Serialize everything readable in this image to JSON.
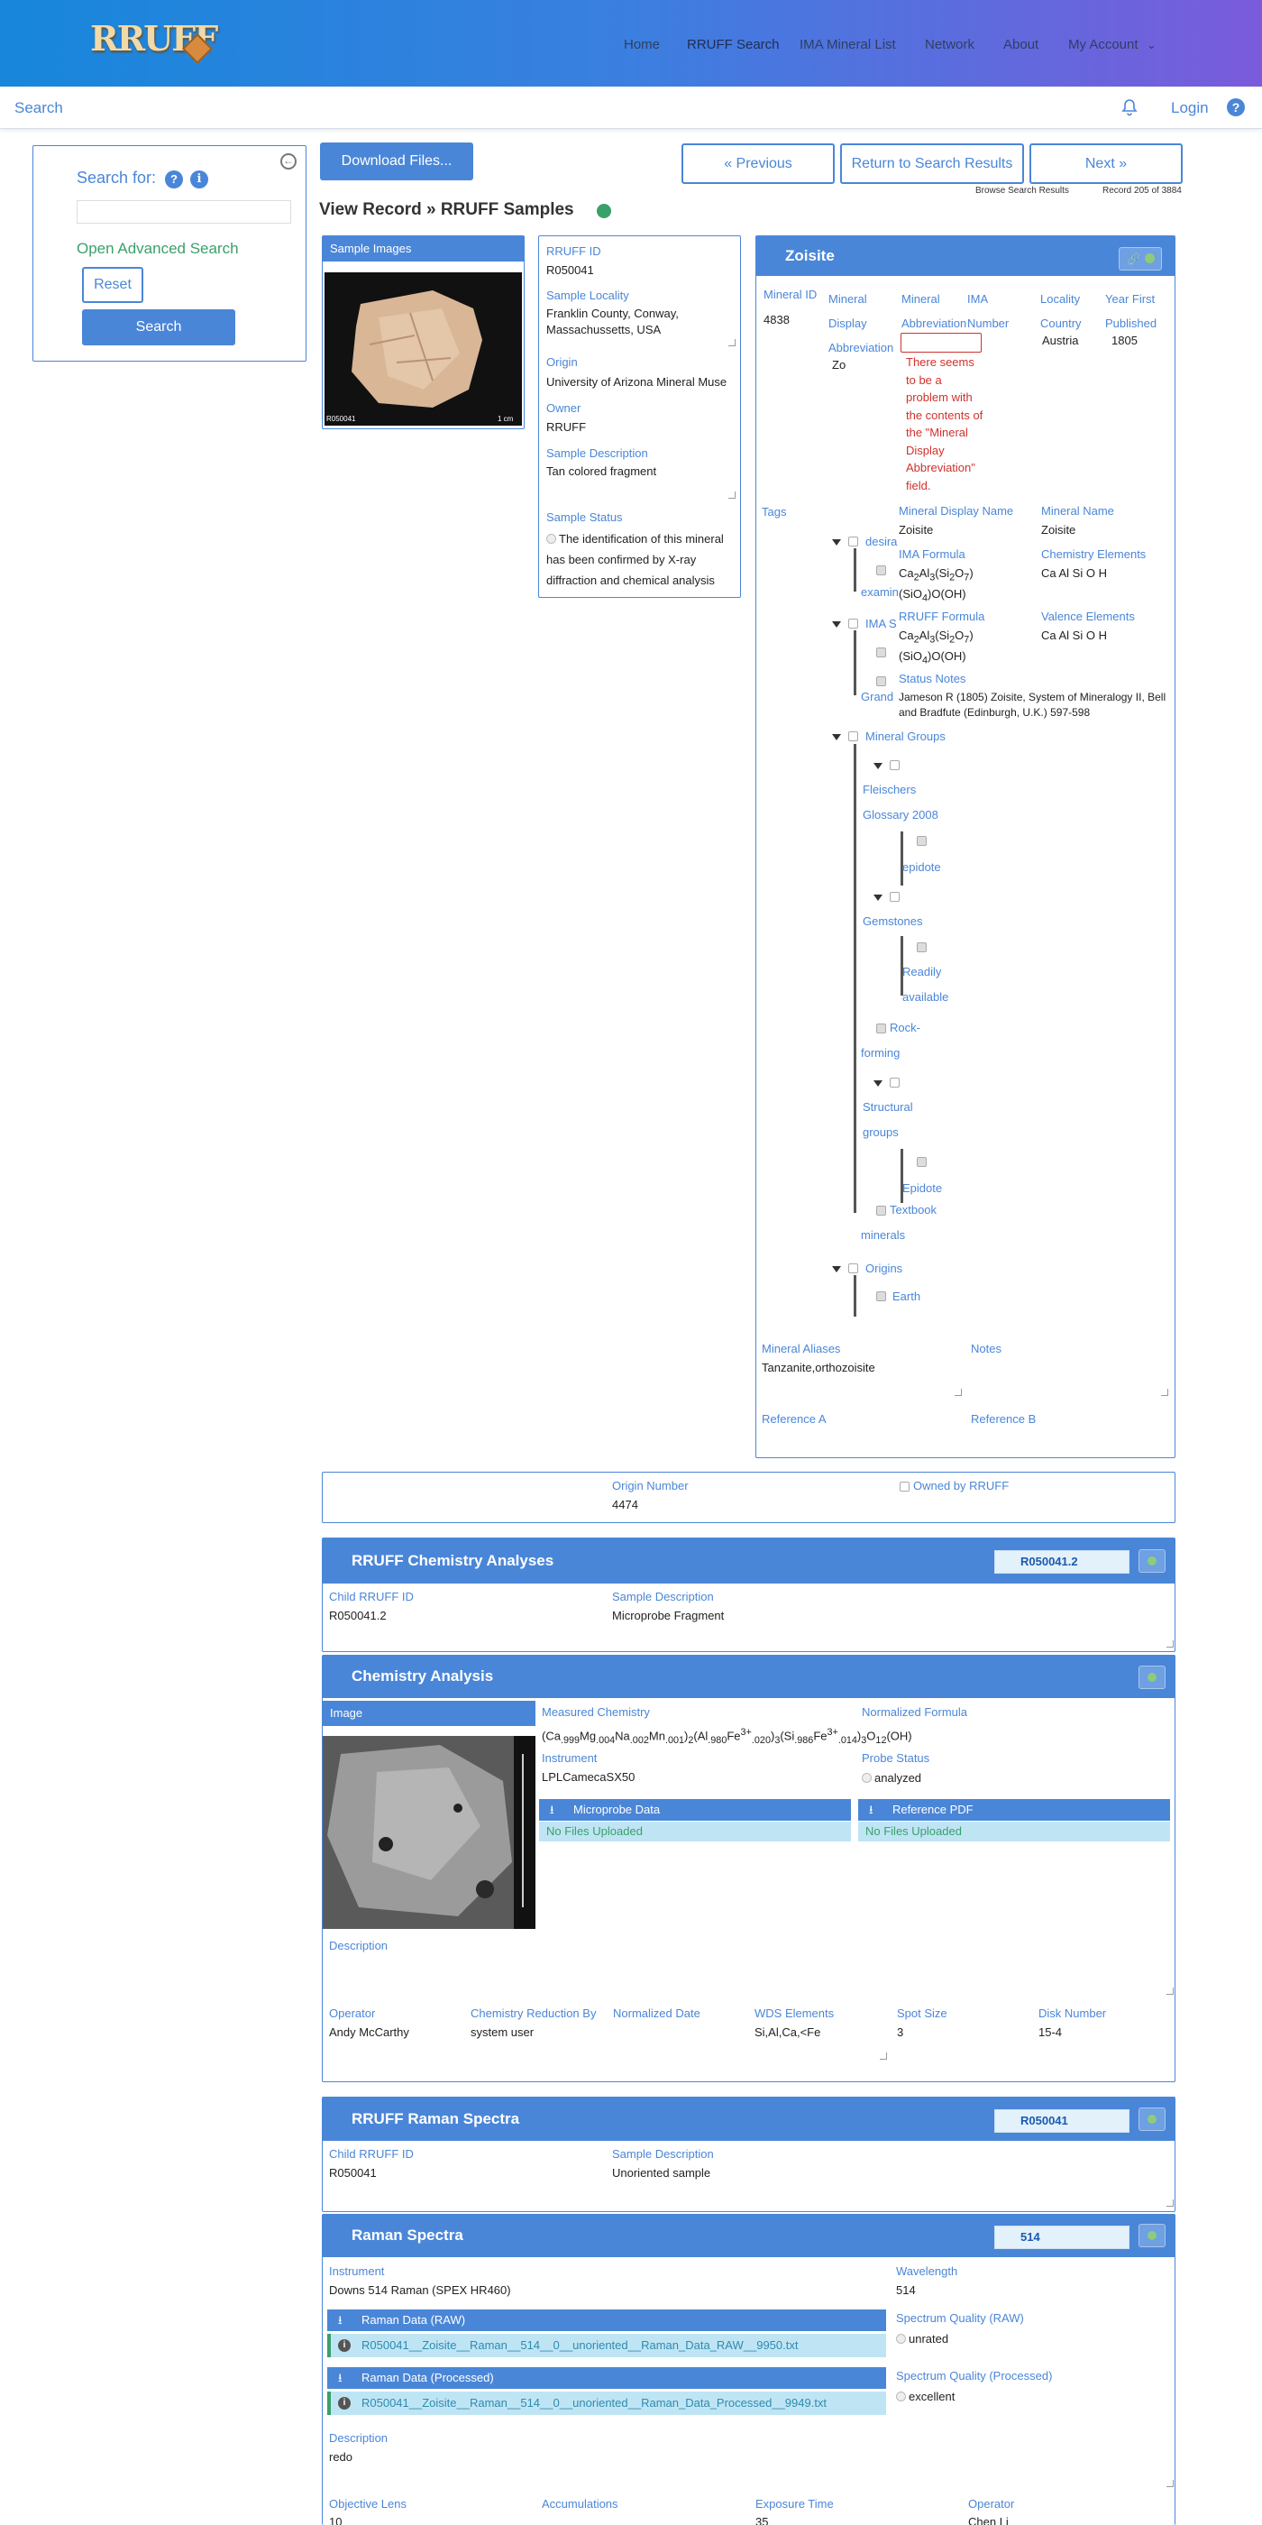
{
  "header": {
    "logo_text": "RRUFF",
    "nav": [
      "Home",
      "RRUFF Search",
      "IMA Mineral List",
      "Network",
      "About",
      "My Account"
    ]
  },
  "subbar": {
    "search_label": "Search",
    "login": "Login",
    "help": "?"
  },
  "sidebar": {
    "search_for": "Search for:",
    "search_value": "",
    "advanced": "Open Advanced Search",
    "reset": "Reset",
    "search": "Search"
  },
  "toolbar": {
    "download": "Download Files...",
    "previous": "Previous",
    "return": "Return to Search Results",
    "next": "Next",
    "browse": "Browse Search Results",
    "record": "Record 205 of 3884"
  },
  "page_title": "View Record » RRUFF Samples",
  "sample_images": {
    "title": "Sample Images",
    "caption_id": "R050041",
    "scale": "1 cm"
  },
  "record": {
    "rruff_id_label": "RRUFF ID",
    "rruff_id": "R050041",
    "locality_label": "Sample Locality",
    "locality": "Franklin County, Conway, Massachussetts, USA",
    "origin_label": "Origin",
    "origin": "University of Arizona Mineral Muse",
    "owner_label": "Owner",
    "owner": "RRUFF",
    "desc_label": "Sample Description",
    "desc": "Tan colored fragment",
    "status_label": "Sample Status",
    "status": "The identification of this mineral has been confirmed by X-ray diffraction and chemical analysis"
  },
  "mineral": {
    "name_title": "Zoisite",
    "col_headers": [
      "Mineral ID",
      "Mineral Display Abbreviation",
      "Mineral Abbreviation",
      "IMA Number",
      "Locality Country",
      "Year First Published"
    ],
    "mineral_id": "4838",
    "display_abbrev": "Zo",
    "abbrev_error": "There seems to be a problem with the contents of the \"Mineral Display Abbreviation\" field.",
    "locality_country": "Austria",
    "year_first": "1805",
    "tags_label": "Tags",
    "tags": {
      "desirability": "desira",
      "examined": "examine",
      "ima": "IMA S",
      "grand": "Grand",
      "mineral_groups": "Mineral Groups",
      "fleischers": "Fleischers Glossary 2008",
      "epidote_lower": "epidote",
      "gemstones": "Gemstones",
      "readily": "Readily available",
      "rock_forming": "Rock-forming",
      "structural": "Structural groups",
      "epidote": "Epidote",
      "textbook": "Textbook minerals",
      "origins": "Origins",
      "earth": "Earth"
    },
    "display_name_label": "Mineral Display Name",
    "display_name": "Zoisite",
    "mineral_name_label": "Mineral Name",
    "mineral_name": "Zoisite",
    "ima_formula_label": "IMA Formula",
    "ima_formula": "Ca2Al3(Si2O7)(SiO4)O(OH)",
    "chem_elements_label": "Chemistry Elements",
    "chem_elements": "Ca Al Si O H",
    "rruff_formula_label": "RRUFF Formula",
    "rruff_formula": "Ca2Al3(Si2O7)(SiO4)O(OH)",
    "valence_label": "Valence Elements",
    "valence": "Ca Al Si O H",
    "status_notes_label": "Status Notes",
    "status_notes": "Jameson R (1805) Zoisite, System of Mineralogy II, Bell and Bradfute (Edinburgh, U.K.) 597-598",
    "aliases_label": "Mineral Aliases",
    "aliases": "Tanzanite,orthozoisite",
    "notes_label": "Notes",
    "ref_a_label": "Reference A",
    "ref_b_label": "Reference B"
  },
  "origin_row": {
    "origin_number_label": "Origin Number",
    "origin_number": "4474",
    "owned_label": "Owned by RRUFF"
  },
  "chem_analyses": {
    "title": "RRUFF Chemistry Analyses",
    "select": "R050041.2",
    "child_label": "Child RRUFF ID",
    "child": "R050041.2",
    "desc_label": "Sample Description",
    "desc": "Microprobe Fragment"
  },
  "chem_analysis": {
    "title": "Chemistry Analysis",
    "image_label": "Image",
    "measured_label": "Measured Chemistry",
    "measured": "(Ca.999Mg.004Na.002Mn.001)2(Al.980Fe3+.020)3(Si.986Fe3+.014)3O12(OH)",
    "normalized_label": "Normalized Formula",
    "instrument_label": "Instrument",
    "instrument": "LPLCamecaSX50",
    "probe_status_label": "Probe Status",
    "probe_status": "analyzed",
    "microprobe_data": "Microprobe Data",
    "microprobe_files": "No Files Uploaded",
    "reference_pdf": "Reference PDF",
    "reference_files": "No Files Uploaded",
    "description_label": "Description",
    "operator_label": "Operator",
    "operator": "Andy McCarthy",
    "reduction_label": "Chemistry Reduction By",
    "reduction": "system user",
    "norm_date_label": "Normalized Date",
    "wds_label": "WDS Elements",
    "wds": "Si,Al,Ca,<Fe",
    "spot_label": "Spot Size",
    "spot": "3",
    "disk_label": "Disk Number",
    "disk": "15-4"
  },
  "raman_spectra_group": {
    "title": "RRUFF Raman Spectra",
    "select": "R050041",
    "child_label": "Child RRUFF ID",
    "child": "R050041",
    "desc_label": "Sample Description",
    "desc": "Unoriented sample"
  },
  "raman": {
    "title": "Raman Spectra",
    "select": "514",
    "instrument_label": "Instrument",
    "instrument": "Downs 514 Raman (SPEX HR460)",
    "wavelength_label": "Wavelength",
    "wavelength": "514",
    "raw_label": "Raman Data (RAW)",
    "raw_file": "R050041__Zoisite__Raman__514__0__unoriented__Raman_Data_RAW__9950.txt",
    "quality_raw_label": "Spectrum Quality (RAW)",
    "quality_raw": "unrated",
    "processed_label": "Raman Data (Processed)",
    "processed_file": "R050041__Zoisite__Raman__514__0__unoriented__Raman_Data_Processed__9949.txt",
    "quality_proc_label": "Spectrum Quality (Processed)",
    "quality_proc": "excellent",
    "description_label": "Description",
    "description": "redo",
    "objective_label": "Objective Lens",
    "objective": "10",
    "accum_label": "Accumulations",
    "exposure_label": "Exposure Time",
    "exposure": "35",
    "operator_label": "Operator",
    "operator": "Chen Li"
  },
  "colors": {
    "accent": "#4a86d8",
    "header_start": "#1787db",
    "header_end": "#7a5bdb",
    "error": "#d0312d"
  }
}
